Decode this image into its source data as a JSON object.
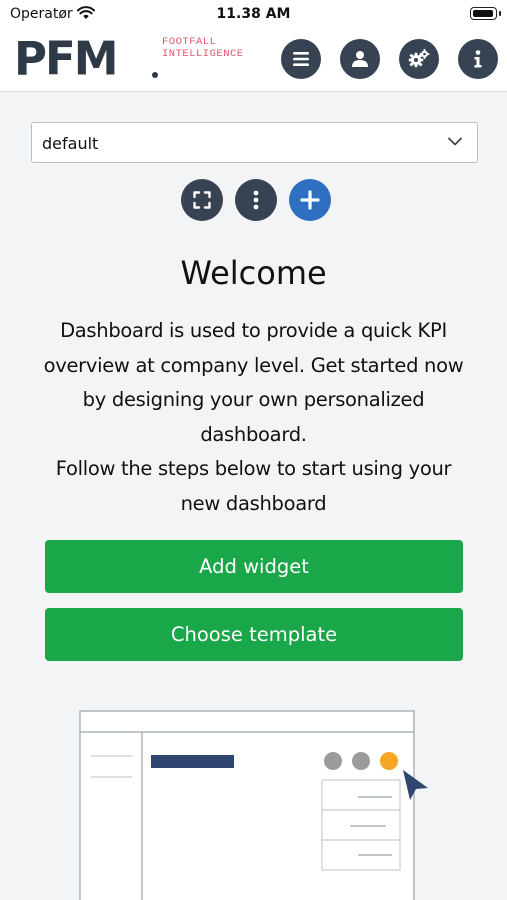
{
  "status_bar": {
    "carrier": "Operatør",
    "time": "11.38 AM",
    "battery_level": 1.0
  },
  "header": {
    "logo_text": "PFM",
    "logo_tagline_1": "FOOTFALL",
    "logo_tagline_2": "INTELLIGENCE",
    "buttons": [
      "menu-icon",
      "user-icon",
      "settings-icon",
      "info-icon"
    ]
  },
  "dashboard_select": {
    "value": "default"
  },
  "actions": [
    "fullscreen-icon",
    "more-vertical-icon",
    "plus-icon"
  ],
  "welcome": {
    "title": "Welcome",
    "text_1": "Dashboard is used to provide a quick KPI overview at company level. Get started now by designing your own personalized dashboard.",
    "text_2": "Follow the steps below to start using your new dashboard"
  },
  "buttons": {
    "add_widget": "Add widget",
    "choose_template": "Choose template"
  },
  "colors": {
    "dark_button": "#374352",
    "blue_button": "#2e6fc2",
    "green_button": "#1aa74a",
    "logo_accent": "#e2556a",
    "illustration_orange": "#f5a623",
    "illustration_navy": "#2f4670"
  }
}
